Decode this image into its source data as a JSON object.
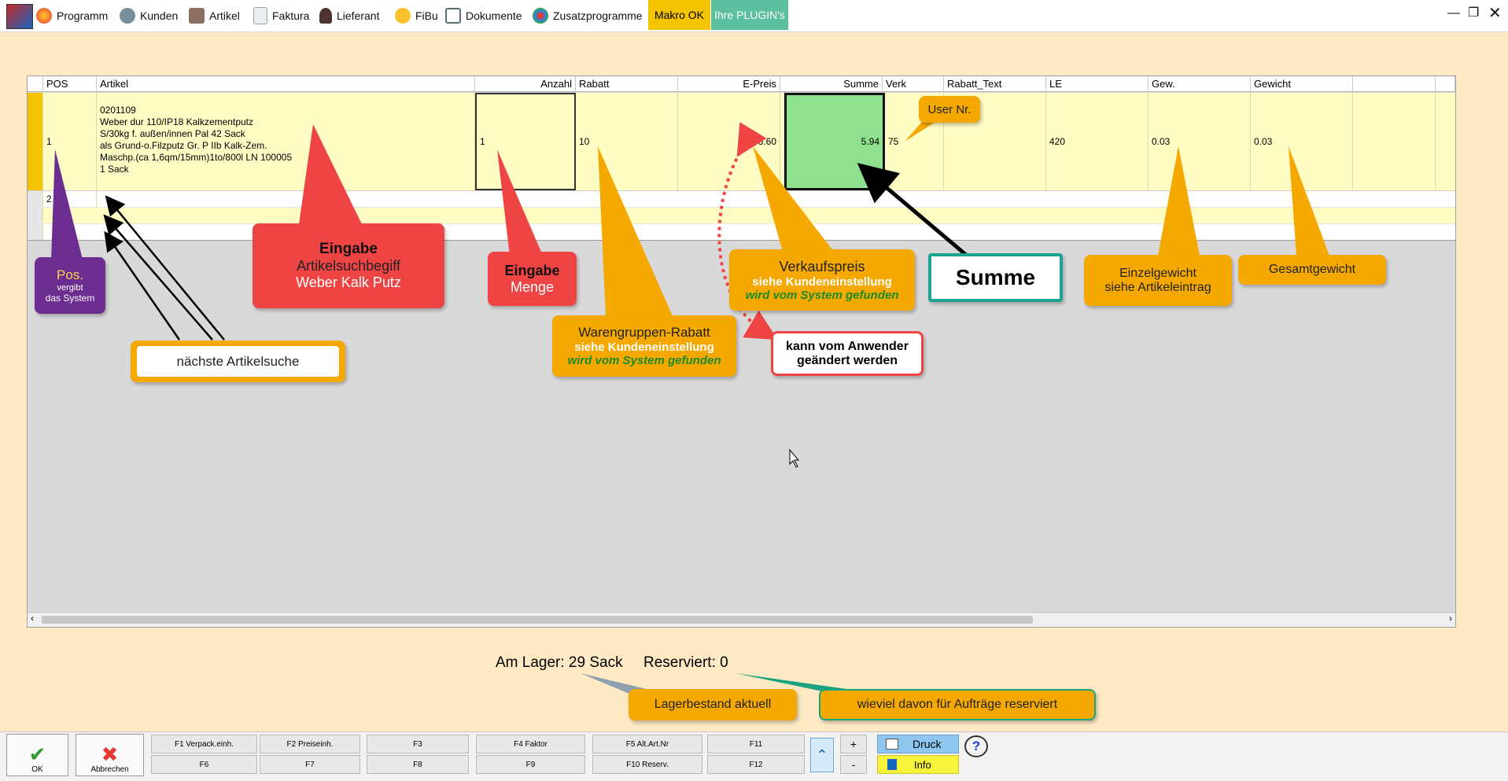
{
  "menu": {
    "items": [
      {
        "label": "Programm",
        "icon": "programm-icon",
        "color": "#e53935"
      },
      {
        "label": "Kunden",
        "icon": "kunden-icon",
        "color": "#607d8b"
      },
      {
        "label": "Artikel",
        "icon": "artikel-icon",
        "color": "#795548"
      },
      {
        "label": "Faktura",
        "icon": "faktura-icon",
        "color": "#90a4ae"
      },
      {
        "label": "Lieferant",
        "icon": "lieferant-icon",
        "color": "#5d4037"
      },
      {
        "label": "FiBu",
        "icon": "fibu-icon",
        "color": "#f9a825"
      },
      {
        "label": "Dokumente",
        "icon": "dokumente-icon",
        "color": "#546e7a"
      },
      {
        "label": "Zusatzprogramme",
        "icon": "zusatzprogramme-icon",
        "color": "#1e88e5"
      }
    ],
    "makro_label": "Makro OK",
    "plugin_label": "Ihre PLUGIN's"
  },
  "table": {
    "columns": [
      "POS",
      "Artikel",
      "Anzahl",
      "Rabatt",
      "E-Preis",
      "Summe",
      "Verk",
      "Rabatt_Text",
      "LE",
      "Gew.",
      "Gewicht"
    ],
    "row1": {
      "pos": "1",
      "artikel_lines": [
        "0201109",
        "Weber dur 110/IP18  Kalkzementputz",
        "S/30kg f. außen/innen Pal 42 Sack",
        "als Grund-o.Filzputz Gr. P IIb Kalk-Zem.",
        "Maschp.(ca 1,6qm/15mm)1to/800l LN 100005",
        "1 Sack"
      ],
      "anzahl": "1",
      "rabatt": "10",
      "epreis": "6.60",
      "summe": "5.94",
      "verk": "75",
      "le": "420",
      "gew": "0.03",
      "gewicht": "0.03"
    },
    "row2_pos": "2"
  },
  "callouts": {
    "user_nr": "User Nr.",
    "pos_title": "Pos.",
    "pos_sub1": "vergibt",
    "pos_sub2": "das System",
    "next_search": "nächste Artikelsuche",
    "eingabe_artikel_title": "Eingabe",
    "eingabe_artikel_l2": "Artikelsuchbegiff",
    "eingabe_artikel_l3": "Weber Kalk Putz",
    "eingabe_menge_title": "Eingabe",
    "eingabe_menge_l2": "Menge",
    "warengruppe_title": "Warengruppen-Rabatt",
    "warengruppe_l2": "siehe Kundeneinstellung",
    "warengruppe_l3": "wird vom System gefunden",
    "verkauf_title": "Verkaufspreis",
    "verkauf_l2": "siehe Kundeneinstellung",
    "verkauf_l3": "wird vom System gefunden",
    "anwender_l1": "kann vom Anwender",
    "anwender_l2": "geändert werden",
    "summe": "Summe",
    "einzel_l1": "Einzelgewicht",
    "einzel_l2": "siehe Artikeleintrag",
    "gesamt": "Gesamtgewicht",
    "lagerbestand": "Lagerbestand aktuell",
    "reserviert_info": "wieviel davon für Aufträge reserviert"
  },
  "status": {
    "lager": "Am Lager: 29 Sack",
    "reserviert": "Reserviert: 0"
  },
  "footer": {
    "ok": "OK",
    "abbrechen": "Abbrechen",
    "f1": "F1 Verpack.einh.",
    "f2": "F2 Preiseinh.",
    "f3": "F3",
    "f4": "F4 Faktor",
    "f5": "F5 Alt.Art.Nr",
    "f11": "F11",
    "f6": "F6",
    "f7": "F7",
    "f8": "F8",
    "f9": "F9",
    "f10": "F10 Reserv.",
    "f12": "F12",
    "plus": "+",
    "minus": "-",
    "druck": "Druck",
    "info": "Info",
    "help": "?"
  }
}
